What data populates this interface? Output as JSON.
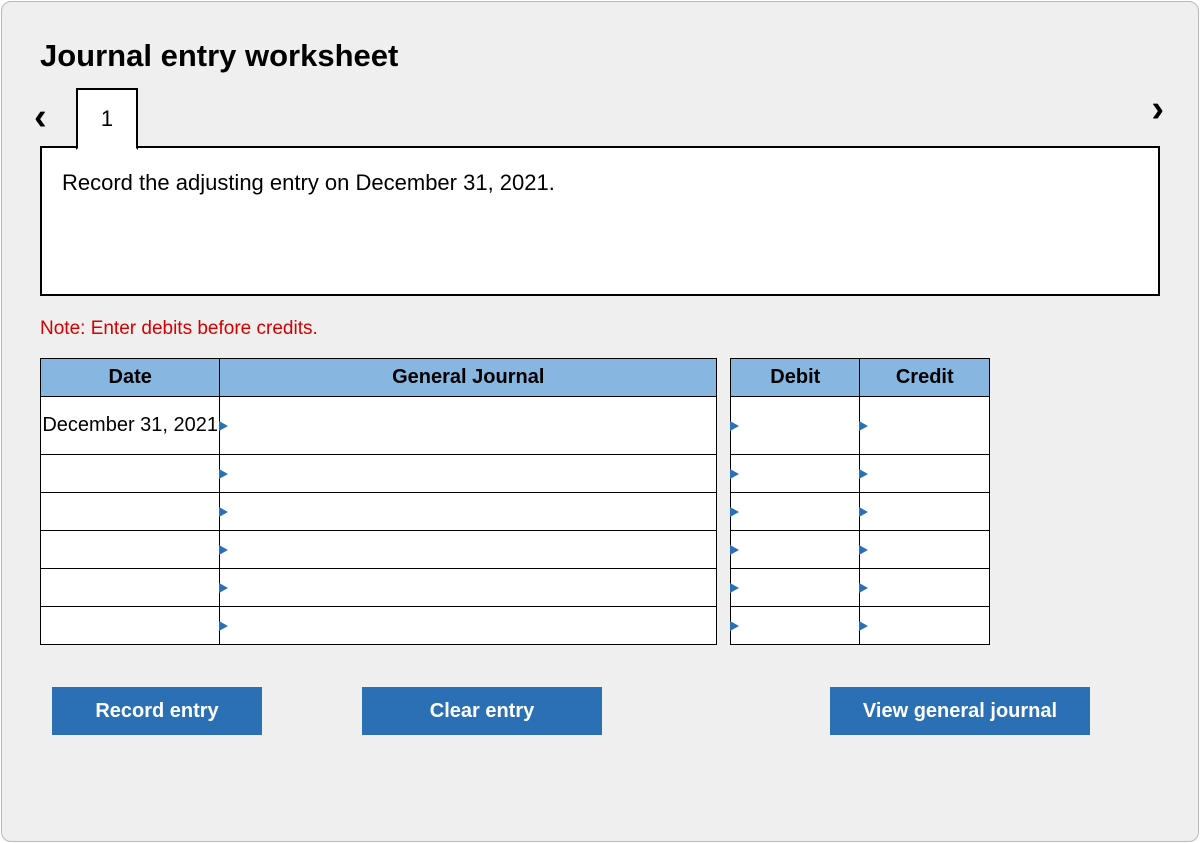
{
  "title": "Journal entry worksheet",
  "nav": {
    "tab_label": "1"
  },
  "instruction": "Record the adjusting entry on December 31, 2021.",
  "note": "Note: Enter debits before credits.",
  "table": {
    "headers": {
      "date": "Date",
      "general_journal": "General Journal",
      "debit": "Debit",
      "credit": "Credit"
    },
    "rows": [
      {
        "date": "December 31, 2021",
        "general_journal": "",
        "debit": "",
        "credit": ""
      },
      {
        "date": "",
        "general_journal": "",
        "debit": "",
        "credit": ""
      },
      {
        "date": "",
        "general_journal": "",
        "debit": "",
        "credit": ""
      },
      {
        "date": "",
        "general_journal": "",
        "debit": "",
        "credit": ""
      },
      {
        "date": "",
        "general_journal": "",
        "debit": "",
        "credit": ""
      },
      {
        "date": "",
        "general_journal": "",
        "debit": "",
        "credit": ""
      }
    ]
  },
  "buttons": {
    "record": "Record entry",
    "clear": "Clear entry",
    "view": "View general journal"
  }
}
